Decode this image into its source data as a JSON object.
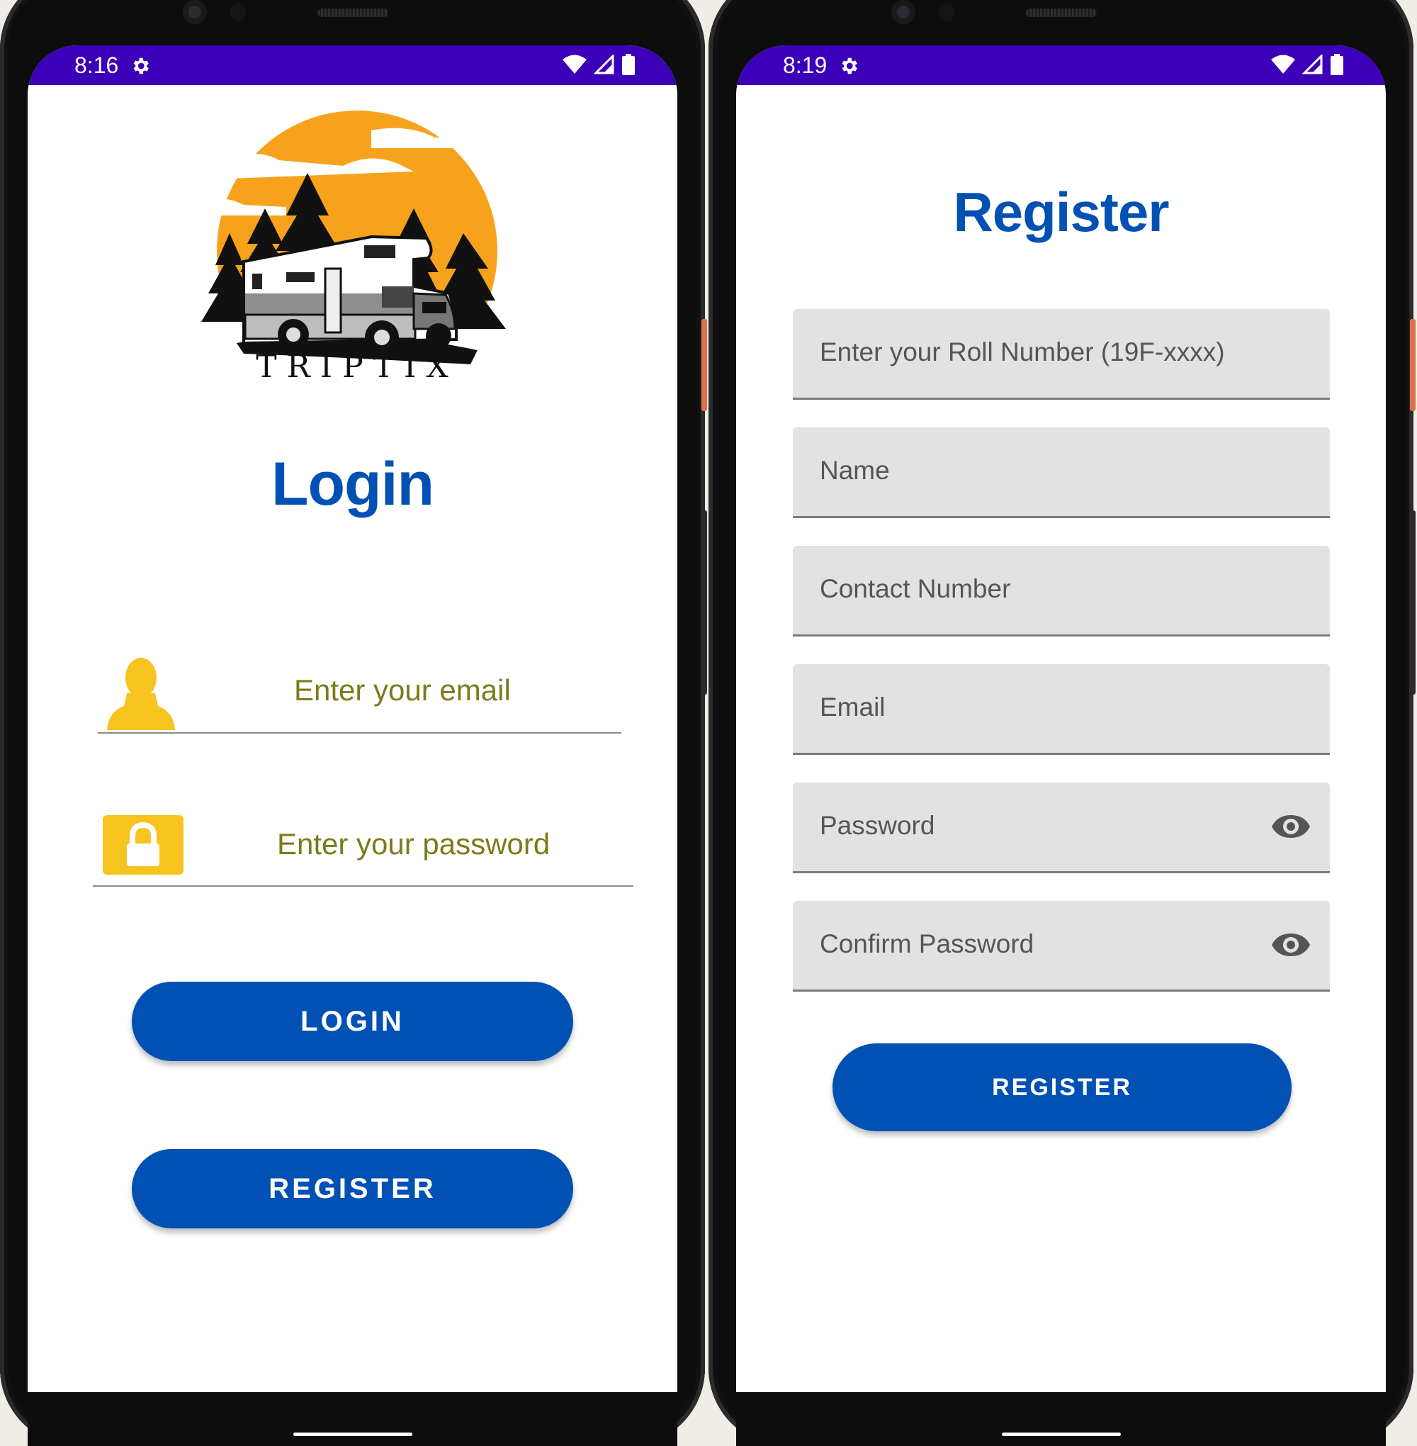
{
  "login_screen": {
    "status_time": "8:16",
    "logo_text": "TRIPTIX",
    "title": "Login",
    "email_placeholder": "Enter your email",
    "password_placeholder": "Enter your password",
    "login_button": "LOGIN",
    "register_button": "REGISTER"
  },
  "register_screen": {
    "status_time": "8:19",
    "title": "Register",
    "fields": [
      {
        "placeholder": "Enter your Roll Number (19F-xxxx)"
      },
      {
        "placeholder": "Name"
      },
      {
        "placeholder": "Contact Number"
      },
      {
        "placeholder": "Email"
      },
      {
        "placeholder": "Password"
      },
      {
        "placeholder": "Confirm Password"
      }
    ],
    "register_button": "REGISTER"
  },
  "icons": {
    "status_bar": [
      "settings-gear-icon",
      "wifi-icon",
      "signal-icon",
      "battery-icon"
    ],
    "login": [
      "user-icon",
      "lock-icon"
    ],
    "register": [
      "eye-icon"
    ]
  },
  "colors": {
    "status_bar": "#3c00b8",
    "primary": "#0051b3",
    "input_text": "#7d7a1a",
    "icon_yellow": "#f7c31f",
    "logo_sun": "#f7a21c",
    "field_bg": "#e2e2e2"
  }
}
